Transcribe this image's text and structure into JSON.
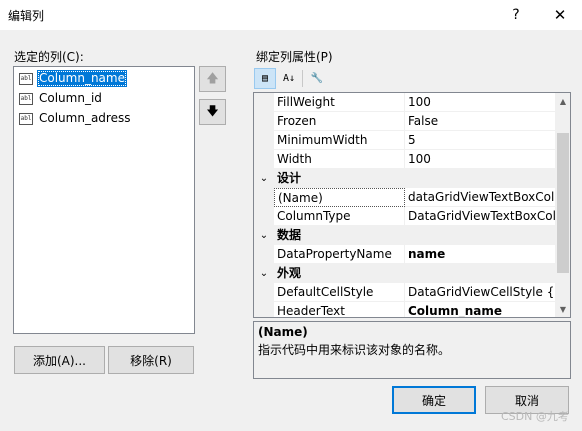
{
  "window": {
    "title": "编辑列",
    "help_glyph": "?",
    "close_glyph": "✕"
  },
  "columns_panel": {
    "label": "选定的列(C):",
    "items": [
      {
        "icon": "textbox-column-icon",
        "label": "Column_name",
        "selected": true
      },
      {
        "icon": "textbox-column-icon",
        "label": "Column_id",
        "selected": false
      },
      {
        "icon": "textbox-column-icon",
        "label": "Column_adress",
        "selected": false
      }
    ],
    "icon_text": "abl",
    "move_up_glyph": "🡅",
    "move_down_glyph": "🡇",
    "add_label": "添加(A)...",
    "remove_label": "移除(R)"
  },
  "properties_panel": {
    "label": "绑定列属性(P)",
    "toolbar": {
      "categorized_icon": "categorized-icon",
      "categorized_glyph": "▤",
      "alphabetical_icon": "alphabetical-sort-icon",
      "alphabetical_glyph": "A↓",
      "property_pages_icon": "wrench-icon",
      "property_pages_glyph": "🔧"
    },
    "rows": [
      {
        "type": "prop",
        "name": "FillWeight",
        "value": "100"
      },
      {
        "type": "prop",
        "name": "Frozen",
        "value": "False"
      },
      {
        "type": "prop",
        "name": "MinimumWidth",
        "value": "5"
      },
      {
        "type": "prop",
        "name": "Width",
        "value": "100"
      },
      {
        "type": "category",
        "name": "设计",
        "glyph": "⌄"
      },
      {
        "type": "prop",
        "name": "(Name)",
        "value": "dataGridViewTextBoxColu",
        "selected": true
      },
      {
        "type": "prop",
        "name": "ColumnType",
        "value": "DataGridViewTextBoxColu"
      },
      {
        "type": "category",
        "name": "数据",
        "glyph": "⌄"
      },
      {
        "type": "prop",
        "name": "DataPropertyName",
        "value": "name",
        "bold": true
      },
      {
        "type": "category",
        "name": "外观",
        "glyph": "⌄"
      },
      {
        "type": "prop",
        "name": "DefaultCellStyle",
        "value": "DataGridViewCellStyle { }"
      },
      {
        "type": "prop",
        "name": "HeaderText",
        "value": "Column_name",
        "bold": true
      }
    ],
    "description": {
      "title": "(Name)",
      "text": "指示代码中用来标识该对象的名称。"
    }
  },
  "footer": {
    "ok_label": "确定",
    "cancel_label": "取消"
  },
  "watermark": "CSDN @九考",
  "colors": {
    "selection": "#0078d7",
    "dialog_bg": "#f0f0f0",
    "border": "#828790"
  }
}
